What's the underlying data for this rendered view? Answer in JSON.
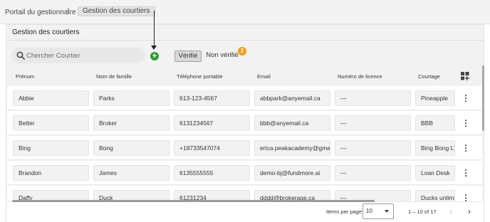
{
  "breadcrumb": {
    "parent": "Portail du gestionnaire",
    "separator": "›",
    "current": "Gestion des courtiers"
  },
  "card": {
    "title": "Gestion des courtiers"
  },
  "search": {
    "placeholder": "Chercher Courtier",
    "value": ""
  },
  "add_button": {
    "label": "+"
  },
  "tabs": [
    {
      "label": "Vérifié",
      "active": true
    },
    {
      "label": "Non vérifié",
      "badge": "2"
    }
  ],
  "colors": {
    "accent_green": "#2e9e2e",
    "badge_orange": "#f39c12"
  },
  "table": {
    "columns": [
      "Prénom",
      "Nom de famille",
      "Téléphone portable",
      "Email",
      "Numéro de licence",
      "Courtage"
    ],
    "rows": [
      [
        "Abbie",
        "Parks",
        "613-123-4567",
        "abbpark@anyemail.ca",
        "—",
        "Pineapple"
      ],
      [
        "Better",
        "Broker",
        "6131234567",
        "bbb@anyemail.ca",
        "—",
        "BBB"
      ],
      [
        "Bing",
        "Bong",
        "+18733547074",
        "erica.peakacademy@gma...",
        "—",
        "Bing Bong LT"
      ],
      [
        "Brandon",
        "James",
        "6135555555",
        "demo-bj@fundmore.ai",
        "—",
        "Loan Desk"
      ],
      [
        "Daffy",
        "Duck",
        "61231234",
        "dddd@brokerage.ca",
        "—",
        "Ducks unlimi"
      ]
    ]
  },
  "pagination": {
    "items_per_page_label": "Items per page:",
    "items_per_page": "10",
    "range": "1 – 10 of 17"
  },
  "icons": {
    "search": "search-icon",
    "add": "plus-circle-icon",
    "columns": "columns-grid-icon",
    "row_menu": "kebab-menu-icon",
    "prev": "chevron-left-icon",
    "next": "chevron-right-icon"
  }
}
